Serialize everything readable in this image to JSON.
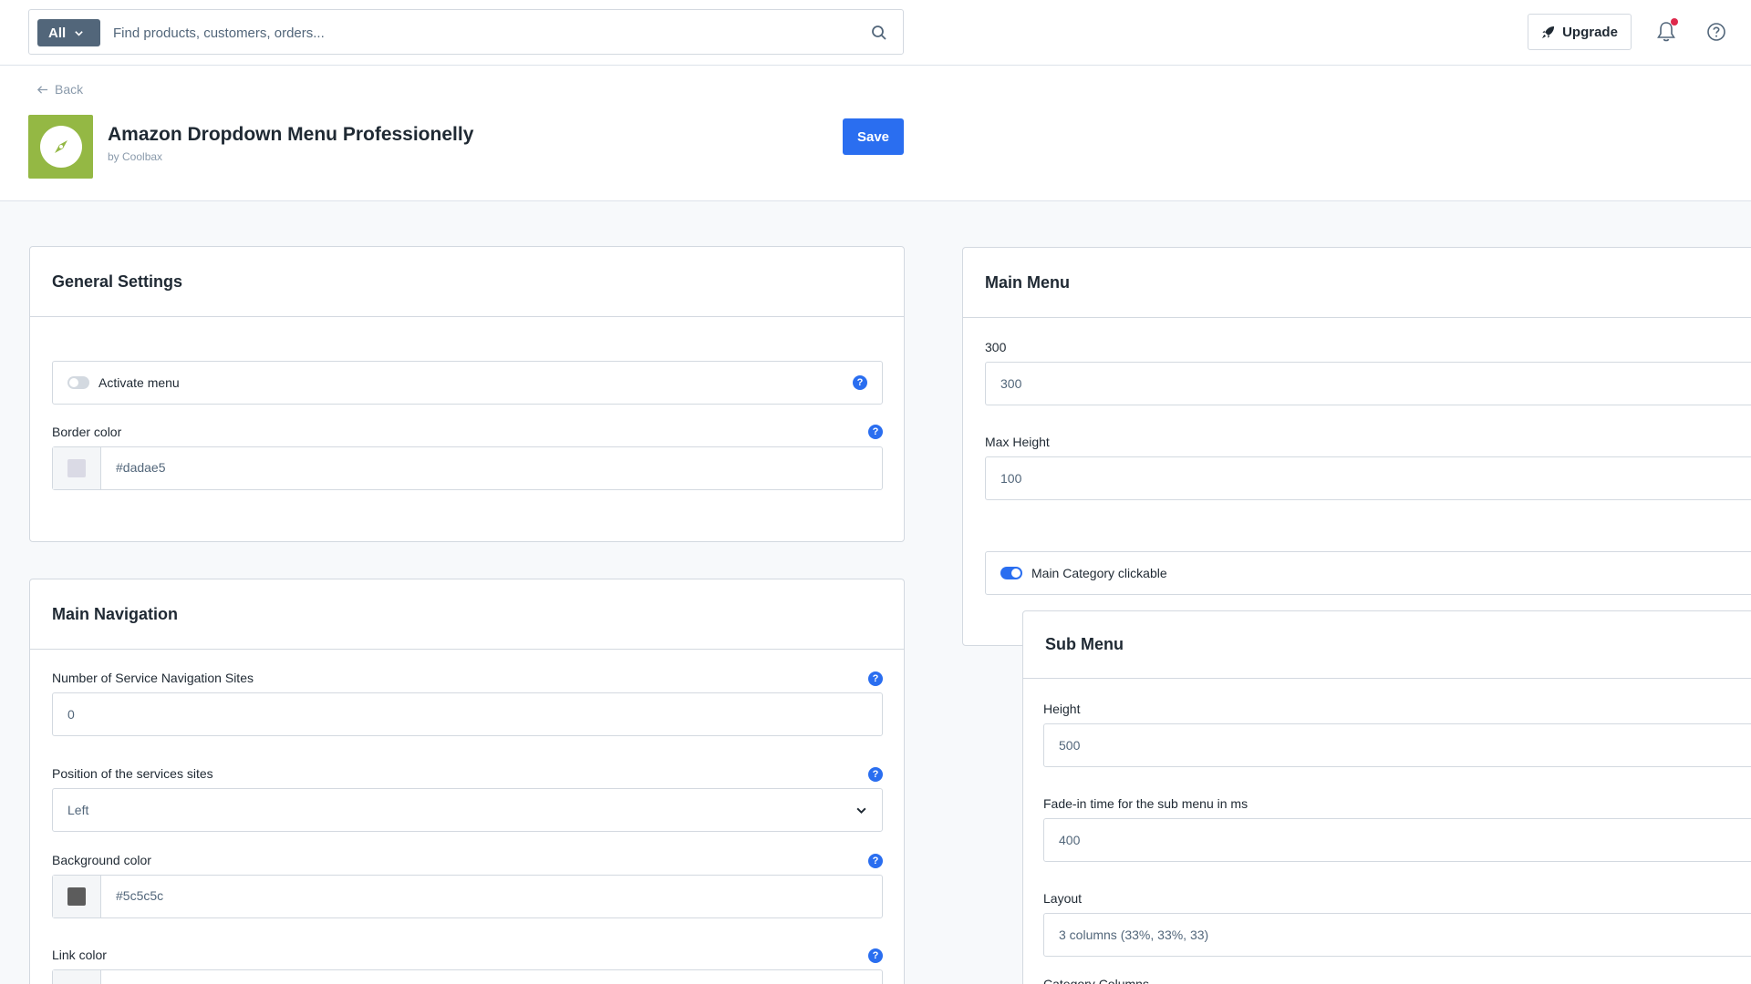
{
  "search": {
    "filter_label": "All",
    "placeholder": "Find products, customers, orders..."
  },
  "topbar": {
    "upgrade_label": "Upgrade"
  },
  "header": {
    "back_label": "Back",
    "title": "Amazon Dropdown Menu Professionelly",
    "author": "by Coolbax",
    "save_label": "Save"
  },
  "general_settings": {
    "title": "General Settings",
    "activate_label": "Activate menu",
    "activate_on": false,
    "border_color_label": "Border color",
    "border_color_value": "#dadae5"
  },
  "main_navigation": {
    "title": "Main Navigation",
    "service_sites_label": "Number of Service Navigation Sites",
    "service_sites_value": "0",
    "position_label": "Position of the services sites",
    "position_value": "Left",
    "background_color_label": "Background color",
    "background_color_value": "#5c5c5c",
    "link_color_label": "Link color"
  },
  "main_menu": {
    "title": "Main Menu",
    "width_label": "300",
    "width_value": "300",
    "max_height_label": "Max Height",
    "max_height_value": "100",
    "clickable_label": "Main Category clickable",
    "clickable_on": true
  },
  "sub_menu": {
    "title": "Sub Menu",
    "height_label": "Height",
    "height_value": "500",
    "fade_label": "Fade-in time for the sub menu in ms",
    "fade_value": "400",
    "layout_label": "Layout",
    "layout_value": "3 columns (33%, 33%, 33)",
    "category_columns_label": "Category Columns"
  },
  "help_glyph": "?",
  "colors": {
    "primary": "#2a6ef0",
    "app_logo": "#94b844",
    "notification": "#de294c"
  }
}
